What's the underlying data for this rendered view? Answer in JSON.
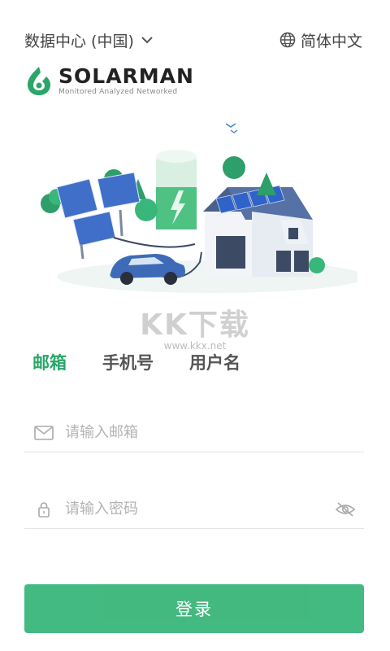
{
  "header": {
    "data_center_label": "数据中心 (中国)",
    "language_label": "简体中文"
  },
  "brand": {
    "name": "SOLARMAN",
    "tagline": "Monitored  Analyzed  Networked"
  },
  "watermark": {
    "big": "KK下载",
    "small": "www.kkx.net"
  },
  "login_tabs": [
    "邮箱",
    "手机号",
    "用户名"
  ],
  "email_field": {
    "placeholder": "请输入邮箱"
  },
  "password_field": {
    "placeholder": "请输入密码"
  },
  "login_button": {
    "label": "登录"
  },
  "colors": {
    "accent": "#2aa66a",
    "button": "#39b67a"
  }
}
